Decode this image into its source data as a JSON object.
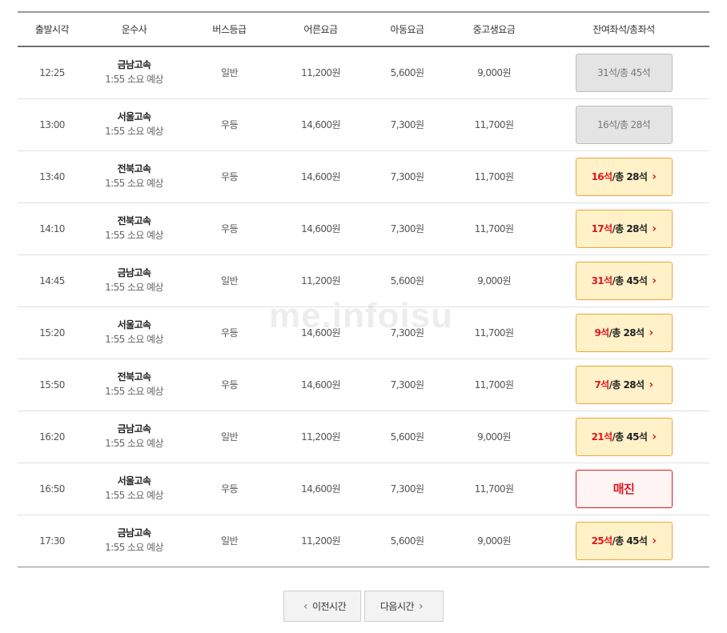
{
  "table": {
    "headers": [
      "출발시각",
      "운수사",
      "버스등급",
      "어른요금",
      "아동요금",
      "중고생요금",
      "잔여좌석/총좌석"
    ],
    "rows": [
      {
        "time": "12:25",
        "operator": "금남고속",
        "duration": "1:55 소요 예상",
        "grade": "일반",
        "adult": "11,200원",
        "child": "5,600원",
        "student": "9,000원",
        "seat_status": "closed",
        "remaining": "31석",
        "total": " /총 45석",
        "chevron": "",
        "soldout_label": ""
      },
      {
        "time": "13:00",
        "operator": "서울고속",
        "duration": "1:55 소요 예상",
        "grade": "우등",
        "adult": "14,600원",
        "child": "7,300원",
        "student": "11,700원",
        "seat_status": "closed",
        "remaining": "16석",
        "total": " /총 28석",
        "chevron": "",
        "soldout_label": ""
      },
      {
        "time": "13:40",
        "operator": "전북고속",
        "duration": "1:55 소요 예상",
        "grade": "우등",
        "adult": "14,600원",
        "child": "7,300원",
        "student": "11,700원",
        "seat_status": "open",
        "remaining": "16석",
        "total": " /총 28석",
        "chevron": "›",
        "soldout_label": ""
      },
      {
        "time": "14:10",
        "operator": "전북고속",
        "duration": "1:55 소요 예상",
        "grade": "우등",
        "adult": "14,600원",
        "child": "7,300원",
        "student": "11,700원",
        "seat_status": "open",
        "remaining": "17석",
        "total": " /총 28석",
        "chevron": "›",
        "soldout_label": ""
      },
      {
        "time": "14:45",
        "operator": "금남고속",
        "duration": "1:55 소요 예상",
        "grade": "일반",
        "adult": "11,200원",
        "child": "5,600원",
        "student": "9,000원",
        "seat_status": "open",
        "remaining": "31석",
        "total": " /총 45석",
        "chevron": "›",
        "soldout_label": ""
      },
      {
        "time": "15:20",
        "operator": "서울고속",
        "duration": "1:55 소요 예상",
        "grade": "우등",
        "adult": "14,600원",
        "child": "7,300원",
        "student": "11,700원",
        "seat_status": "open",
        "remaining": "9석",
        "total": " /총 28석",
        "chevron": "›",
        "soldout_label": ""
      },
      {
        "time": "15:50",
        "operator": "전북고속",
        "duration": "1:55 소요 예상",
        "grade": "우등",
        "adult": "14,600원",
        "child": "7,300원",
        "student": "11,700원",
        "seat_status": "open",
        "remaining": "7석",
        "total": " /총 28석",
        "chevron": "›",
        "soldout_label": ""
      },
      {
        "time": "16:20",
        "operator": "금남고속",
        "duration": "1:55 소요 예상",
        "grade": "일반",
        "adult": "11,200원",
        "child": "5,600원",
        "student": "9,000원",
        "seat_status": "open",
        "remaining": "21석",
        "total": " /총 45석",
        "chevron": "›",
        "soldout_label": ""
      },
      {
        "time": "16:50",
        "operator": "서울고속",
        "duration": "1:55 소요 예상",
        "grade": "우등",
        "adult": "14,600원",
        "child": "7,300원",
        "student": "11,700원",
        "seat_status": "soldout",
        "remaining": "",
        "total": "",
        "chevron": "",
        "soldout_label": "매진"
      },
      {
        "time": "17:30",
        "operator": "금남고속",
        "duration": "1:55 소요 예상",
        "grade": "일반",
        "adult": "11,200원",
        "child": "5,600원",
        "student": "9,000원",
        "seat_status": "open",
        "remaining": "25석",
        "total": " /총 45석",
        "chevron": "›",
        "soldout_label": ""
      }
    ]
  },
  "pagination": {
    "prev_icon": "‹",
    "prev_label": "이전시간",
    "next_label": "다음시간",
    "next_icon": "›"
  },
  "watermark": "me.infoisu",
  "colors": {
    "accent_red": "#e0161e",
    "open_bg": "#fff2c8",
    "open_border": "#f0a23a",
    "closed_bg": "#e4e4e4"
  }
}
